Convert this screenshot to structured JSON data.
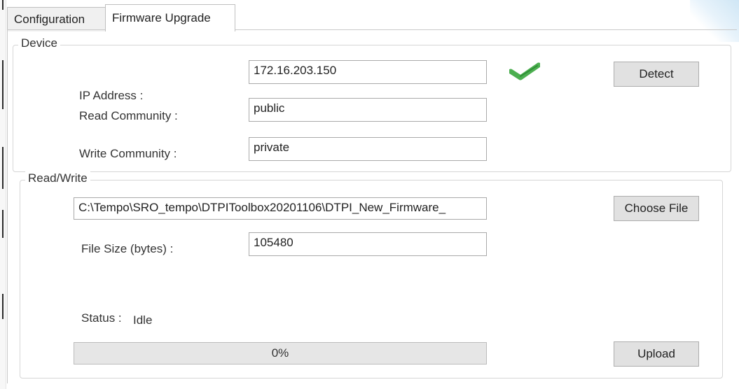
{
  "tabs": [
    {
      "label": "Configuration",
      "active": false
    },
    {
      "label": "Firmware Upgrade",
      "active": true
    }
  ],
  "device_group": {
    "title": "Device",
    "ip_label": "IP Address :",
    "ip_value": "172.16.203.150",
    "read_label": "Read Community :",
    "read_value": "public",
    "write_label": "Write Community :",
    "write_value": "private",
    "detect_label": "Detect",
    "detect_status_icon": "checkmark-icon",
    "check_color": "#4caf50"
  },
  "rw_group": {
    "title": "Read/Write",
    "file_path": "C:\\Tempo\\SRO_tempo\\DTPIToolbox20201106\\DTPI_New_Firmware_",
    "choose_label": "Choose File",
    "size_label": "File Size (bytes) :",
    "size_value": "105480",
    "status_label": "Status :",
    "status_value": "Idle",
    "progress_percent": 0,
    "progress_text": "0%",
    "upload_label": "Upload"
  }
}
